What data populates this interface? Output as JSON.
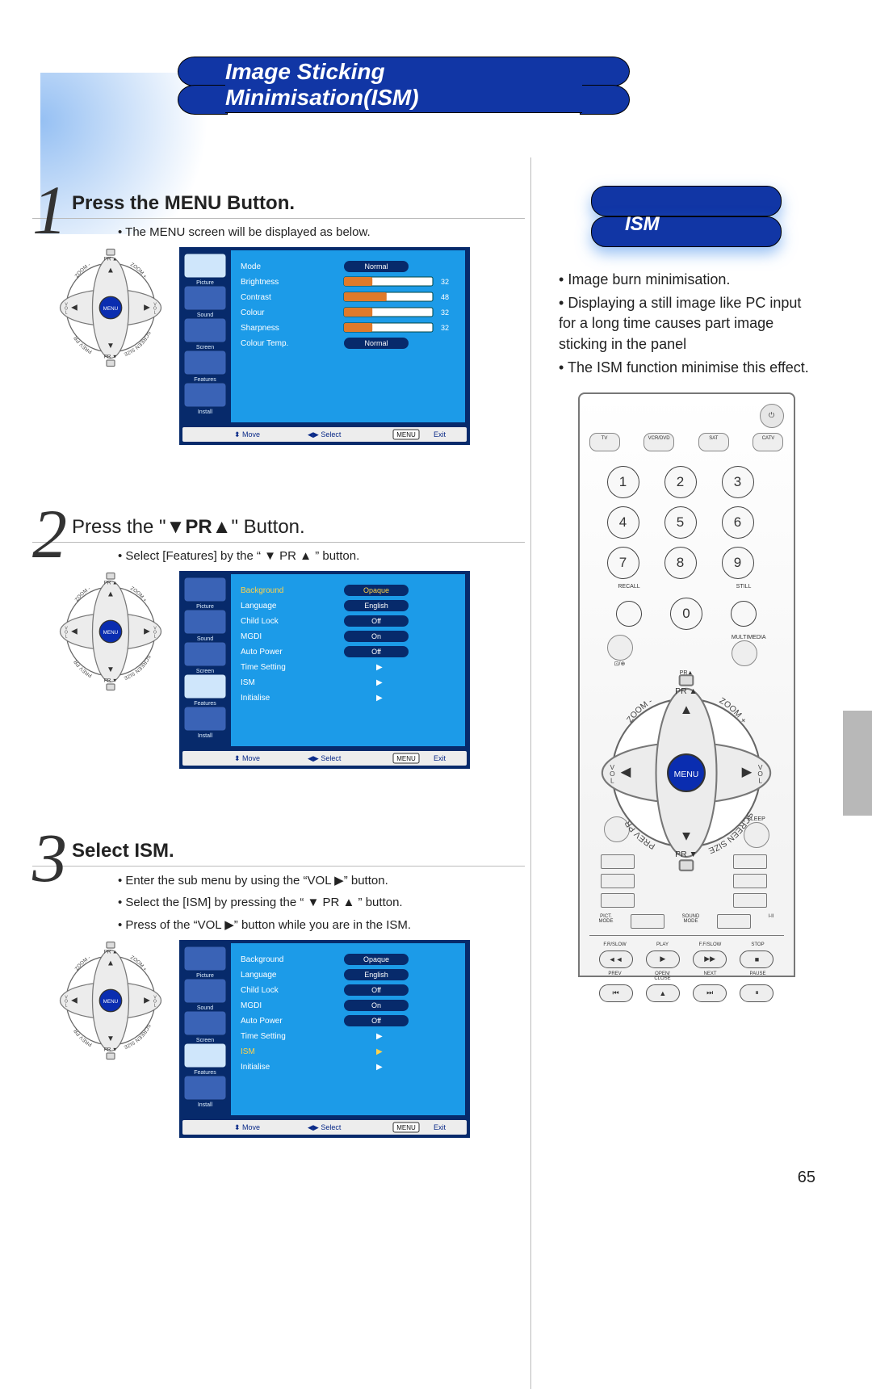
{
  "page_number": "65",
  "title": "Image Sticking Minimisation(ISM)",
  "dpad_labels": {
    "pr_up": "PR",
    "pr_dn": "PR",
    "zoom_minus": "ZOOM -",
    "zoom_plus": "ZOOM +",
    "prev_pr": "PREV PR",
    "screen_size": "SCREEN SIZE",
    "vol_l": "VOL",
    "vol_r": "VOL",
    "menu": "MENU"
  },
  "osd_sidebar": [
    "Picture",
    "Sound",
    "Screen",
    "Features",
    "Install"
  ],
  "osd_footer": {
    "move": "Move",
    "select": "Select",
    "menu": "MENU",
    "exit": "Exit"
  },
  "steps": [
    {
      "num": "1",
      "title_a": "Press the MENU Button.",
      "notes": [
        "The MENU screen will be displayed as below."
      ],
      "osd_rows": [
        {
          "label": "Mode",
          "val": "Normal",
          "type": "pill"
        },
        {
          "label": "Brightness",
          "val": "32",
          "type": "bar",
          "pct": 32
        },
        {
          "label": "Contrast",
          "val": "48",
          "type": "bar",
          "pct": 48
        },
        {
          "label": "Colour",
          "val": "32",
          "type": "bar",
          "pct": 32
        },
        {
          "label": "Sharpness",
          "val": "32",
          "type": "bar",
          "pct": 32
        },
        {
          "label": "Colour Temp.",
          "val": "Normal",
          "type": "pill"
        }
      ],
      "sidebar_sel": 0
    },
    {
      "num": "2",
      "title_plain_a": "Press the \"",
      "title_plain_b": "\" Button.",
      "title_mid": "PR",
      "notes": [
        "Select [Features] by the “ ▼ PR ▲ ” button."
      ],
      "osd_rows": [
        {
          "label": "Background",
          "val": "Opaque",
          "type": "pillsel"
        },
        {
          "label": "Language",
          "val": "English",
          "type": "pill"
        },
        {
          "label": "Child Lock",
          "val": "Off",
          "type": "pill"
        },
        {
          "label": "MGDI",
          "val": "On",
          "type": "pill"
        },
        {
          "label": "Auto Power",
          "val": "Off",
          "type": "pill"
        },
        {
          "label": "Time Setting",
          "val": "▶",
          "type": "arrow"
        },
        {
          "label": "ISM",
          "val": "▶",
          "type": "arrow"
        },
        {
          "label": "Initialise",
          "val": "▶",
          "type": "arrow"
        }
      ],
      "sidebar_sel": 3
    },
    {
      "num": "3",
      "title_a": "Select ISM.",
      "notes": [
        "Enter the sub menu by using the “VOL ▶” button.",
        "Select the [ISM] by pressing the “ ▼ PR ▲ ” button.",
        "Press of the “VOL ▶” button while you are in the ISM."
      ],
      "osd_rows": [
        {
          "label": "Background",
          "val": "Opaque",
          "type": "pill"
        },
        {
          "label": "Language",
          "val": "English",
          "type": "pill"
        },
        {
          "label": "Child Lock",
          "val": "Off",
          "type": "pill"
        },
        {
          "label": "MGDI",
          "val": "On",
          "type": "pill"
        },
        {
          "label": "Auto Power",
          "val": "Off",
          "type": "pill"
        },
        {
          "label": "Time Setting",
          "val": "▶",
          "type": "arrow"
        },
        {
          "label": "ISM",
          "val": "▶",
          "type": "arrowsel"
        },
        {
          "label": "Initialise",
          "val": "▶",
          "type": "arrow"
        }
      ],
      "sidebar_sel": 3
    }
  ],
  "sidebar": {
    "pill_label": "ISM",
    "bullets": [
      "Image burn minimisation.",
      "Displaying a still image like PC input for a long time causes part image sticking in the panel",
      "The ISM function minimise this effect."
    ]
  },
  "remote": {
    "sources": [
      "TV",
      "VCR/DVD",
      "SAT",
      "CATV"
    ],
    "recall": "RECALL",
    "still": "STILL",
    "multimedia": "MULTIMEDIA",
    "sleep": "SLEEP",
    "pict_mode": "PICT.\nMODE",
    "sound_mode": "SOUND\nMODE",
    "i_ii": "I-II",
    "play_row1": [
      "F.R/SLOW",
      "PLAY",
      "F.F/SLOW",
      "STOP"
    ],
    "play_sym1": [
      "◄◄",
      "▶",
      "▶▶",
      "■"
    ],
    "play_row2": [
      "PREV",
      "OPEN/\nCLOSE",
      "NEXT",
      "PAUSE"
    ],
    "play_sym2": [
      "⏮",
      "▲",
      "⏭",
      "⏸"
    ]
  }
}
